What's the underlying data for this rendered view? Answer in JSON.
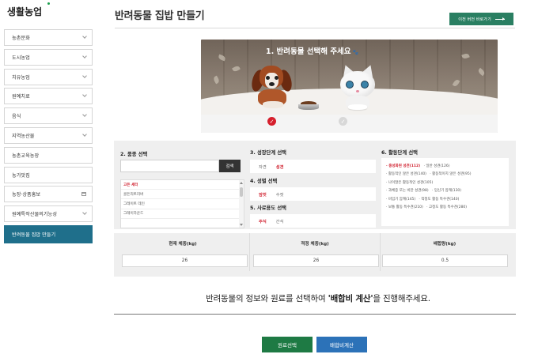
{
  "brand": "생활농업",
  "sidebar": {
    "items": [
      {
        "label": "농촌문화",
        "icon": "chevron-down"
      },
      {
        "label": "도시농업",
        "icon": "chevron-down"
      },
      {
        "label": "치유농업",
        "icon": "chevron-down"
      },
      {
        "label": "원예치료",
        "icon": "chevron-down"
      },
      {
        "label": "음식",
        "icon": "chevron-down"
      },
      {
        "label": "지역농산물",
        "icon": "chevron-down"
      },
      {
        "label": "농촌교육농장",
        "icon": ""
      },
      {
        "label": "농가맛집",
        "icon": ""
      },
      {
        "label": "농장·상품홍보",
        "icon": "external-link"
      },
      {
        "label": "원예특작산물의기능성",
        "icon": "chevron-down"
      },
      {
        "label": "반려동물 집밥 만들기",
        "icon": "",
        "active": true
      }
    ]
  },
  "header": {
    "title": "반려동물 집밥 만들기",
    "prev_version_button": "이전 버전 바로가기"
  },
  "banner": {
    "title": "1. 반려동물 선택해 주세요",
    "selected_animal": "dog"
  },
  "form": {
    "breed": {
      "label": "2. 품종 선택",
      "search_value": "",
      "search_button": "검색",
      "items": [
        "고든 세터",
        "골든리트리버",
        "그레이트 데인",
        "그레이하운드"
      ]
    },
    "growth": {
      "label": "3. 성장단계 선택",
      "options": [
        "자견",
        "성견"
      ],
      "selected": "성견"
    },
    "sex": {
      "label": "4. 성별 선택",
      "options": [
        "암컷",
        "수컷"
      ],
      "selected": "암컷"
    },
    "usage": {
      "label": "5. 사료용도 선택",
      "options": [
        "주식",
        "간식"
      ],
      "selected": "주식"
    },
    "activity": {
      "label": "6. 활동단계 선택",
      "lines": [
        [
          "· 중성화된 성견(112)",
          "· 일반 성견(126)"
        ],
        [
          "· 활동적인 않은 성견(140)",
          "· 활동적이지 않은 성견(95)"
        ],
        [
          "· 나이많은 활동적인 성견(105)",
          ""
        ],
        [
          "· 과체중 또는 비만 성견(98)",
          "· 임신기 암캐(130)"
        ],
        [
          "· 비임기 암캐(145)",
          "· 적정도 활동 특수견(140)"
        ],
        [
          "· 보통 활동 특수견(210)",
          "· 고정도 활동 특수견(280)"
        ]
      ],
      "selected": "· 중성화된 성견(112)"
    }
  },
  "results": {
    "current_weight": {
      "label": "현재 체중(kg)",
      "value": "26"
    },
    "ideal_weight": {
      "label": "적정 체중(kg)",
      "value": "26"
    },
    "feed_amount": {
      "label": "배합량(kg)",
      "value": "0.5"
    }
  },
  "message": {
    "before": "반려동물의 정보와 원료를 선택하여 ",
    "highlight": "'배합비 계산'",
    "after": "을 진행해주세요."
  },
  "buttons": {
    "select_ingredients": "원료선택",
    "calculate_ratio": "배합비계산"
  },
  "colors": {
    "accent_green": "#1e7a44",
    "accent_blue": "#2c72b8",
    "active_nav": "#1f6f8b",
    "selection_red": "#d0202e"
  }
}
